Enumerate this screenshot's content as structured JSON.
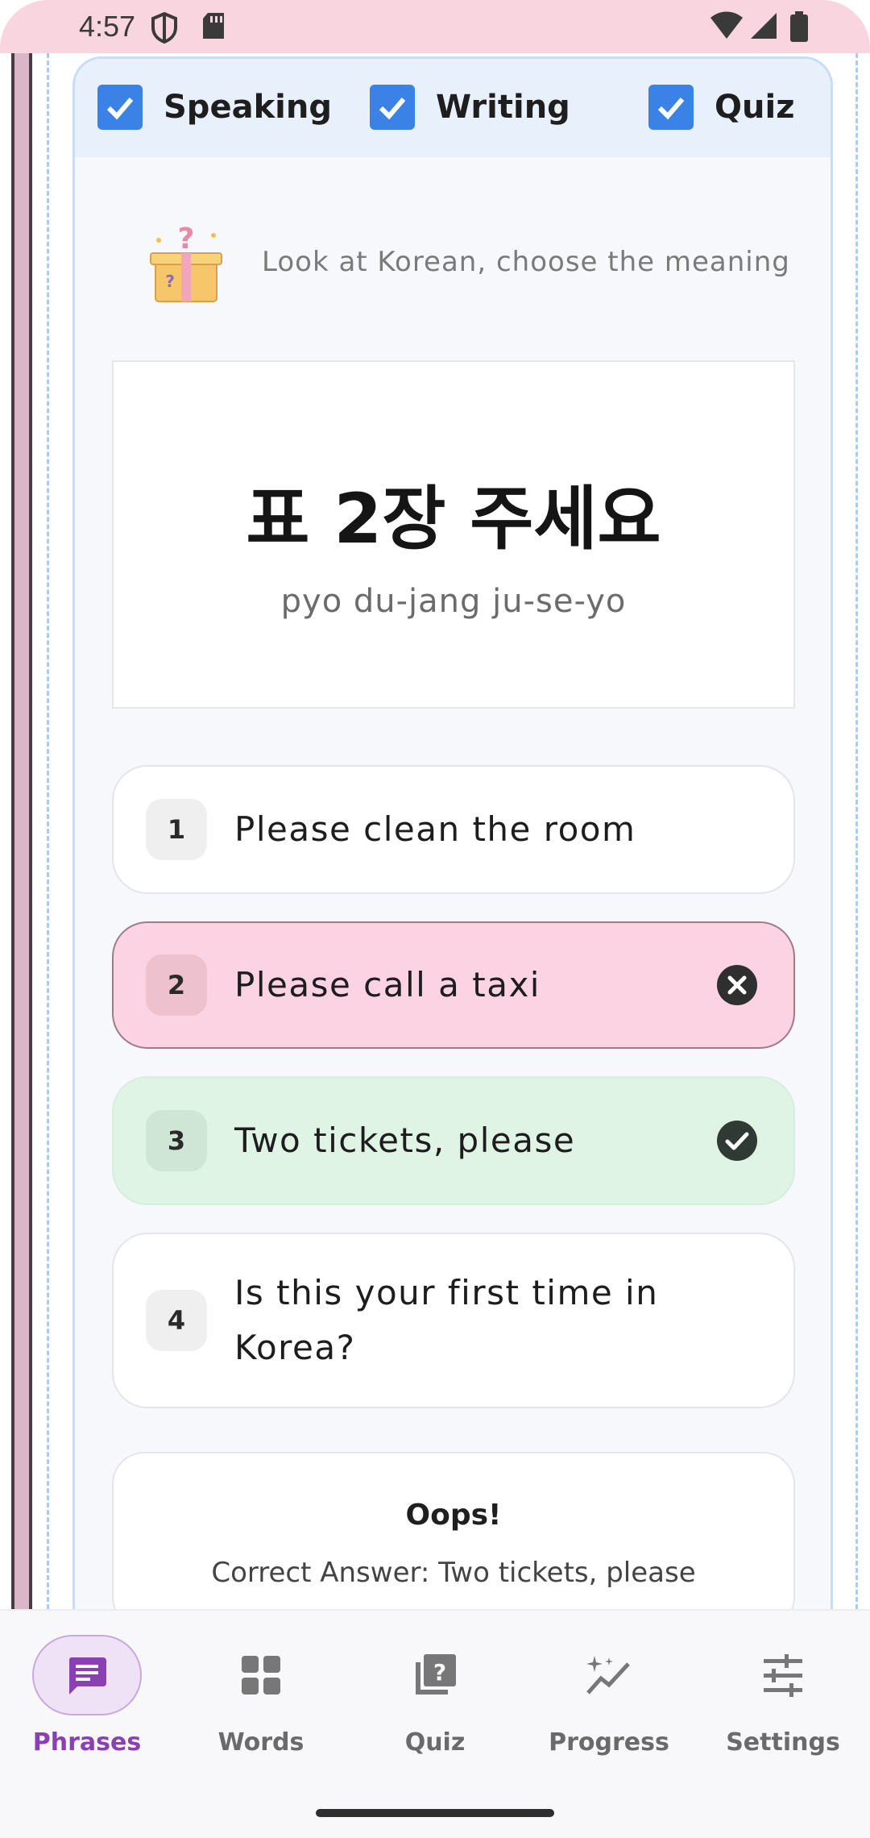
{
  "status_bar": {
    "time": "4:57"
  },
  "toggles": [
    {
      "label": "Speaking",
      "checked": true
    },
    {
      "label": "Writing",
      "checked": true
    },
    {
      "label": "Quiz",
      "checked": true
    }
  ],
  "instruction": "Look at Korean, choose the meaning",
  "phrase": {
    "korean": "표 2장 주세요",
    "romanization": "pyo du-jang ju-se-yo"
  },
  "options": [
    {
      "number": "1",
      "text": "Please clean the room",
      "state": "neutral"
    },
    {
      "number": "2",
      "text": "Please call a taxi",
      "state": "wrong"
    },
    {
      "number": "3",
      "text": "Two tickets, please",
      "state": "correct"
    },
    {
      "number": "4",
      "text": "Is this your first time in Korea?",
      "state": "neutral"
    }
  ],
  "feedback": {
    "title": "Oops!",
    "message": "Correct Answer: Two tickets, please"
  },
  "nav": [
    {
      "label": "Phrases",
      "icon": "chat-bubble-icon",
      "active": true
    },
    {
      "label": "Words",
      "icon": "grid-icon",
      "active": false
    },
    {
      "label": "Quiz",
      "icon": "quiz-icon",
      "active": false
    },
    {
      "label": "Progress",
      "icon": "sparkle-chart-icon",
      "active": false
    },
    {
      "label": "Settings",
      "icon": "sliders-icon",
      "active": false
    }
  ],
  "colors": {
    "accent": "#8a3fb2",
    "checkbox": "#3b82e6",
    "wrong_bg": "#fcd3e2",
    "correct_bg": "#dff4e5"
  }
}
